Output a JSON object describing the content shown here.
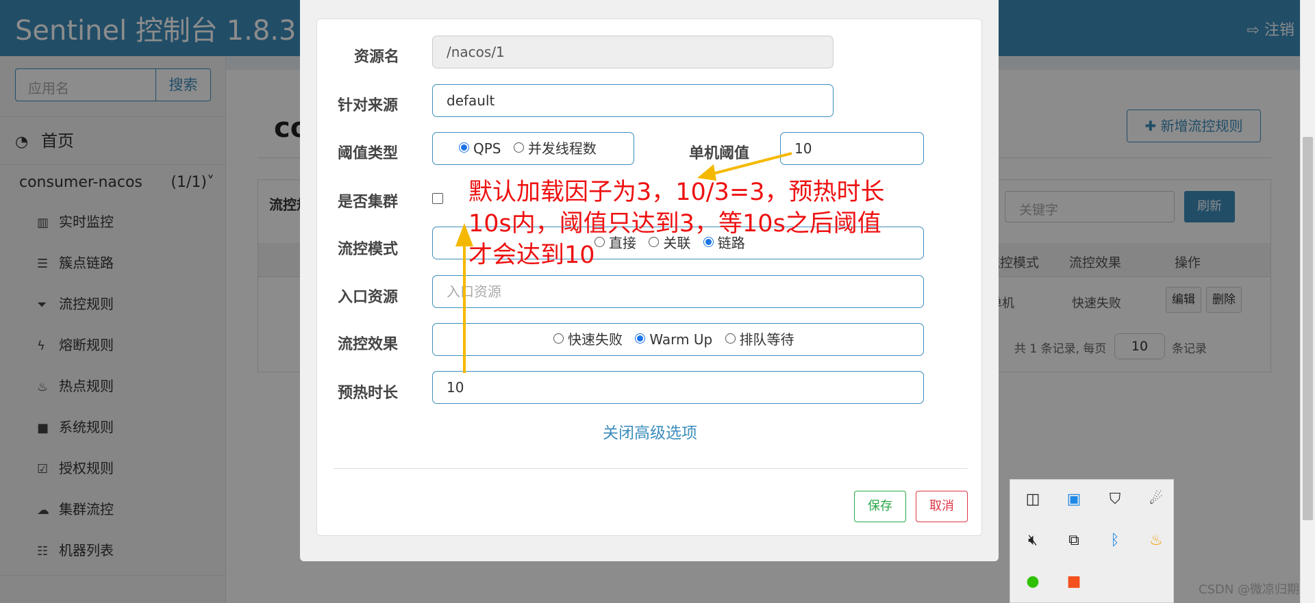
{
  "app": {
    "title": "Sentinel 控制台 1.8.3",
    "logout": "注销"
  },
  "sidebar": {
    "search_placeholder": "应用名",
    "search_button": "搜索",
    "home": "首页",
    "app_name": "consumer-nacos",
    "app_count": "(1/1)",
    "items": [
      {
        "icon": "bar-chart-icon",
        "label": "实时监控"
      },
      {
        "icon": "list-icon",
        "label": "簇点链路"
      },
      {
        "icon": "filter-icon",
        "label": "流控规则"
      },
      {
        "icon": "bolt-icon",
        "label": "熔断规则"
      },
      {
        "icon": "fire-icon",
        "label": "热点规则"
      },
      {
        "icon": "lock-icon",
        "label": "系统规则"
      },
      {
        "icon": "check-square-icon",
        "label": "授权规则"
      },
      {
        "icon": "cloud-icon",
        "label": "集群流控"
      },
      {
        "icon": "list-alt-icon",
        "label": "机器列表"
      }
    ]
  },
  "main": {
    "page_title": "co",
    "add_button": "新增流控规则",
    "box_title": "流控规",
    "keyword_placeholder": "关键字",
    "refresh": "刷新",
    "headers": [
      "流控模式",
      "流控效果",
      "操作"
    ],
    "row": {
      "mode": "单机",
      "effect": "快速失败",
      "edit": "编辑",
      "delete": "删除"
    },
    "pager_before": "共 1 条记录, 每页",
    "page_size": "10",
    "pager_after": "条记录"
  },
  "modal": {
    "resource_label": "资源名",
    "resource_value": "/nacos/1",
    "source_label": "针对来源",
    "source_value": "default",
    "threshold_type_label": "阈值类型",
    "threshold_type_options": [
      "QPS",
      "并发线程数"
    ],
    "threshold_type_selected": "QPS",
    "single_threshold_label": "单机阈值",
    "single_threshold_value": "10",
    "cluster_label": "是否集群",
    "cluster_checked": false,
    "mode_label": "流控模式",
    "mode_options": [
      "直接",
      "关联",
      "链路"
    ],
    "mode_selected": "链路",
    "entry_label": "入口资源",
    "entry_placeholder": "入口资源",
    "effect_label": "流控效果",
    "effect_options": [
      "快速失败",
      "Warm Up",
      "排队等待"
    ],
    "effect_selected": "Warm Up",
    "warmup_label": "预热时长",
    "warmup_value": "10",
    "advanced_link": "关闭高级选项",
    "save": "保存",
    "cancel": "取消"
  },
  "annotation": {
    "lines": [
      "默认加载因子为3，10/3=3，预热时长",
      "10s内，阈值只达到3，等10s之后阈值",
      "才会达到10"
    ],
    "color": "#ee1111",
    "arrow_color": "#f5b800"
  },
  "tray": {
    "icons": [
      "dolby-icon",
      "image-app-icon",
      "security-shield-icon",
      "satellite-icon",
      "muted-speaker-icon",
      "window-switch-icon",
      "bluetooth-icon",
      "flame-app-icon",
      "wechat-icon",
      "media-app-icon"
    ]
  },
  "watermark": "CSDN @微凉归期"
}
